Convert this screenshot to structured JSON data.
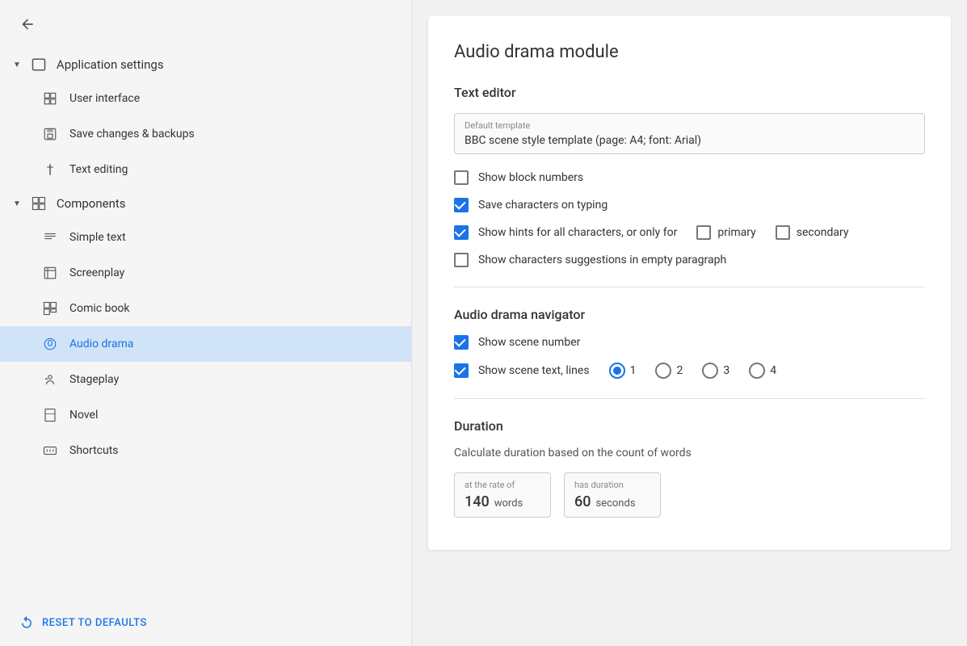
{
  "sidebar": {
    "back_aria": "back",
    "sections": [
      {
        "id": "application-settings",
        "label": "Application settings",
        "expanded": true,
        "items": [
          {
            "id": "user-interface",
            "label": "User interface",
            "icon": "ui-icon"
          },
          {
            "id": "save-changes",
            "label": "Save changes & backups",
            "icon": "save-icon"
          },
          {
            "id": "text-editing",
            "label": "Text editing",
            "icon": "text-edit-icon"
          }
        ]
      },
      {
        "id": "components",
        "label": "Components",
        "expanded": true,
        "items": [
          {
            "id": "simple-text",
            "label": "Simple text",
            "icon": "simple-text-icon"
          },
          {
            "id": "screenplay",
            "label": "Screenplay",
            "icon": "screenplay-icon"
          },
          {
            "id": "comic-book",
            "label": "Comic book",
            "icon": "comic-book-icon"
          },
          {
            "id": "audio-drama",
            "label": "Audio drama",
            "icon": "audio-drama-icon",
            "active": true
          },
          {
            "id": "stageplay",
            "label": "Stageplay",
            "icon": "stageplay-icon"
          },
          {
            "id": "novel",
            "label": "Novel",
            "icon": "novel-icon"
          }
        ]
      }
    ],
    "shortcuts": {
      "label": "Shortcuts",
      "icon": "shortcuts-icon"
    },
    "reset_label": "RESET TO DEFAULTS"
  },
  "main": {
    "module_title": "Audio drama module",
    "text_editor": {
      "section_title": "Text editor",
      "default_template_label": "Default template",
      "default_template_value": "BBC scene style template (page: A4; font: Arial)",
      "checkboxes": [
        {
          "id": "show-block-numbers",
          "label": "Show block numbers",
          "checked": false
        },
        {
          "id": "save-characters",
          "label": "Save characters on typing",
          "checked": true
        },
        {
          "id": "show-hints",
          "label": "Show hints for all characters, or only for",
          "checked": true,
          "extended": true,
          "options": [
            {
              "id": "primary",
              "label": "primary",
              "checked": false
            },
            {
              "id": "secondary",
              "label": "secondary",
              "checked": false
            }
          ]
        },
        {
          "id": "show-suggestions",
          "label": "Show characters suggestions in empty paragraph",
          "checked": false
        }
      ]
    },
    "audio_drama_navigator": {
      "section_title": "Audio drama navigator",
      "checkboxes": [
        {
          "id": "show-scene-number",
          "label": "Show scene number",
          "checked": true
        }
      ],
      "radio_row": {
        "id": "show-scene-text",
        "label": "Show scene text, lines",
        "checked": true,
        "selected": "1",
        "options": [
          {
            "value": "1",
            "label": "1"
          },
          {
            "value": "2",
            "label": "2"
          },
          {
            "value": "3",
            "label": "3"
          },
          {
            "value": "4",
            "label": "4"
          }
        ]
      }
    },
    "duration": {
      "section_title": "Duration",
      "description": "Calculate duration based on the count of words",
      "rate_label": "at the rate of",
      "rate_value": "140",
      "rate_unit": "words",
      "duration_label": "has duration",
      "duration_value": "60",
      "duration_unit": "seconds"
    }
  }
}
